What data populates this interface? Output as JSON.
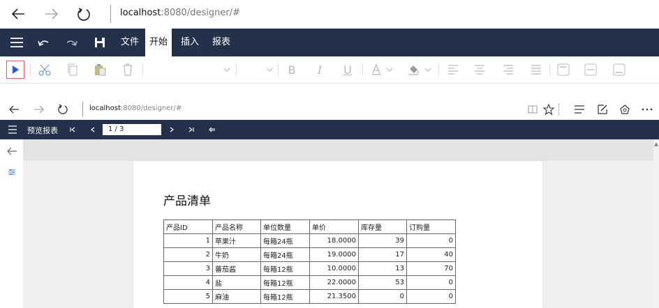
{
  "browser": {
    "url_host": "localhost",
    "url_rest": ":8080/designer/#"
  },
  "designer_menu": {
    "tabs": [
      "文件",
      "开始",
      "插入",
      "报表"
    ],
    "active_tab": "开始"
  },
  "inner_browser": {
    "url_host": "localhost",
    "url_rest": ":8080/designer/#"
  },
  "preview_toolbar": {
    "title": "预览报表",
    "page_indicator": "1 / 3"
  },
  "report": {
    "title": "产品清单",
    "columns": [
      "产品ID",
      "产品名称",
      "单位数量",
      "单价",
      "库存量",
      "订购量"
    ],
    "rows": [
      [
        "1",
        "苹果汁",
        "每箱24瓶",
        "18.0000",
        "39",
        "0"
      ],
      [
        "2",
        "牛奶",
        "每箱24瓶",
        "19.0000",
        "17",
        "40"
      ],
      [
        "3",
        "蕃茄酱",
        "每箱12瓶",
        "10.0000",
        "13",
        "70"
      ],
      [
        "4",
        "盐",
        "每箱12瓶",
        "22.0000",
        "53",
        "0"
      ],
      [
        "5",
        "麻油",
        "每箱12瓶",
        "21.3500",
        "0",
        "0"
      ]
    ]
  },
  "colors": {
    "header_bg": "#25304a",
    "ribbon_icon": "#b8b8b8",
    "run_icon": "#2a5cc9",
    "run_border": "#e05a5a"
  }
}
